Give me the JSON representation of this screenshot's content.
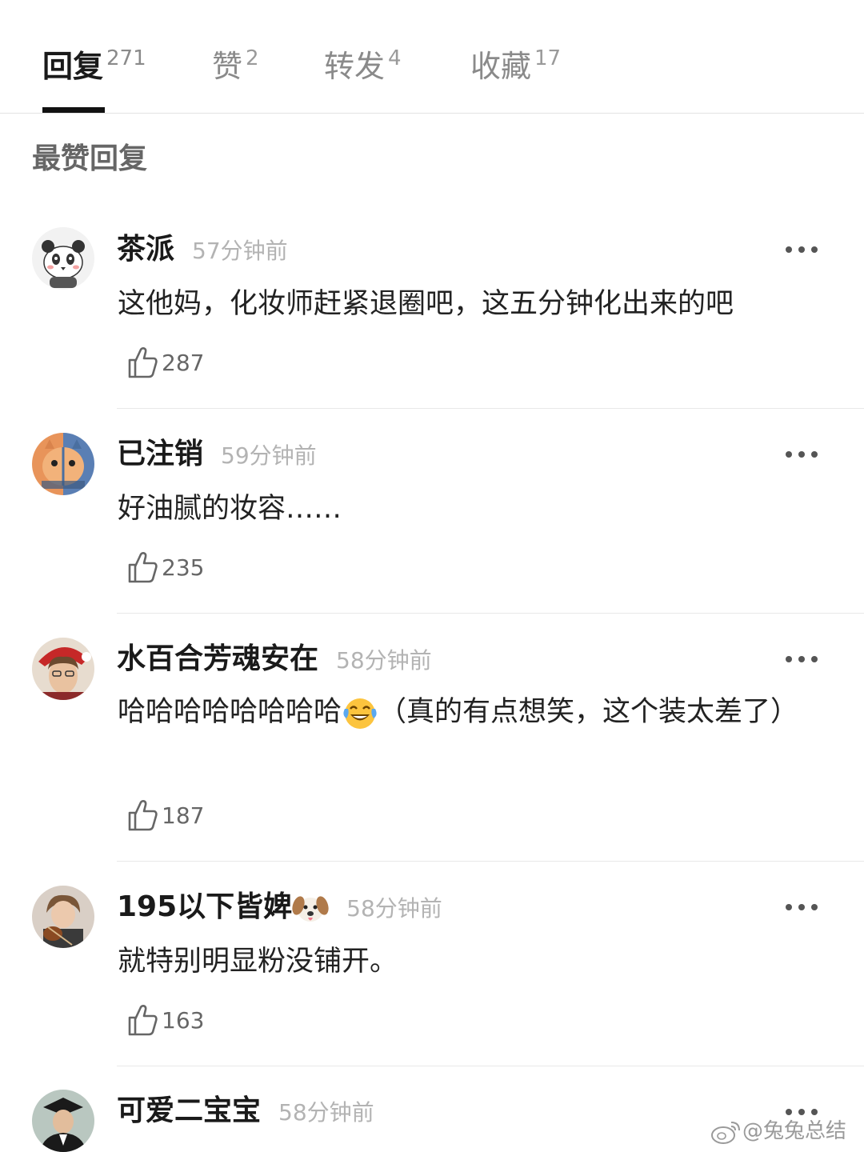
{
  "tabs": [
    {
      "label": "回复",
      "count": "271",
      "active": true
    },
    {
      "label": "赞",
      "count": "2",
      "active": false
    },
    {
      "label": "转发",
      "count": "4",
      "active": false
    },
    {
      "label": "收藏",
      "count": "17",
      "active": false
    }
  ],
  "section_title": "最赞回复",
  "comments": [
    {
      "username": "茶派",
      "time": "57分钟前",
      "text": "这他妈，化妆师赶紧退圈吧，这五分钟化出来的吧",
      "likes": "287",
      "avatar_icon": "panda-avatar"
    },
    {
      "username": "已注销",
      "time": "59分钟前",
      "text": "好油腻的妆容……",
      "likes": "235",
      "avatar_icon": "cat-avatar"
    },
    {
      "username": "水百合芳魂安在",
      "time": "58分钟前",
      "text_before_emoji": "哈哈哈哈哈哈哈哈",
      "emoji": "laughing-tears-emoji",
      "text_after_emoji": "（真的有点想笑，这个装太差了）",
      "likes": "187",
      "avatar_icon": "person-santa-hat-avatar"
    },
    {
      "username": "195以下皆婢",
      "username_emoji": "dog-face-emoji",
      "time": "58分钟前",
      "text": "就特别明显粉没铺开。",
      "likes": "163",
      "avatar_icon": "person-violin-avatar"
    },
    {
      "username": "可爱二宝宝",
      "time": "58分钟前",
      "avatar_icon": "graduate-avatar"
    }
  ],
  "watermark": {
    "text": "@兔兔总结",
    "icon": "weibo-icon"
  },
  "colors": {
    "active_tab": "#1a1a1a",
    "inactive_tab": "#8a8a8a",
    "timestamp": "#b3b3b3",
    "divider": "#e8e8e8"
  }
}
